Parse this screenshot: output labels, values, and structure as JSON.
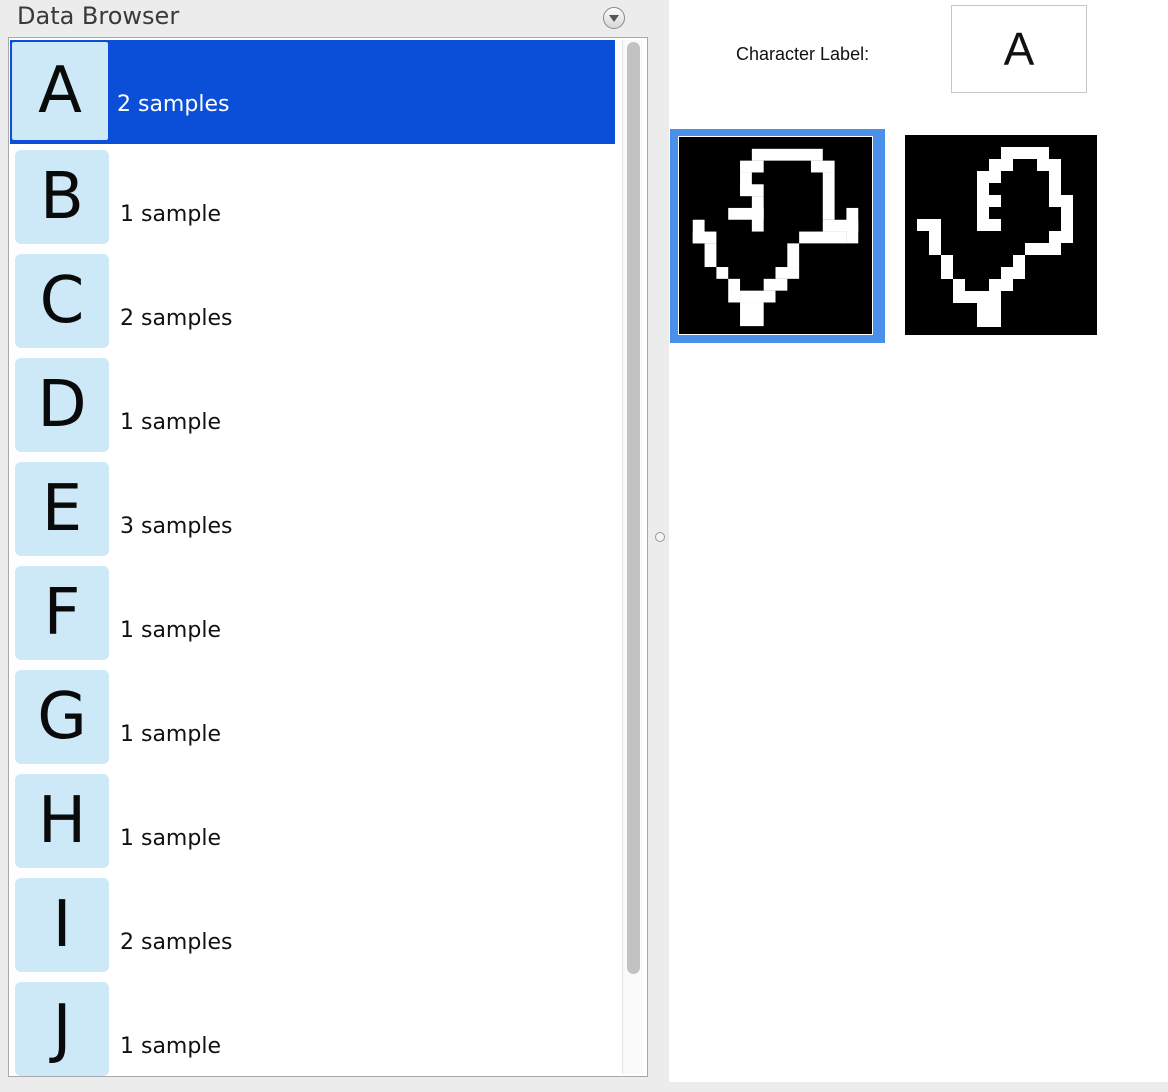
{
  "panel": {
    "title": "Data Browser",
    "menu_icon": "dropdown-circle-icon"
  },
  "list": {
    "items": [
      {
        "letter": "A",
        "count": "2 samples",
        "selected": true
      },
      {
        "letter": "B",
        "count": "1 sample",
        "selected": false
      },
      {
        "letter": "C",
        "count": "2 samples",
        "selected": false
      },
      {
        "letter": "D",
        "count": "1 sample",
        "selected": false
      },
      {
        "letter": "E",
        "count": "3 samples",
        "selected": false
      },
      {
        "letter": "F",
        "count": "1 sample",
        "selected": false
      },
      {
        "letter": "G",
        "count": "1 sample",
        "selected": false
      },
      {
        "letter": "H",
        "count": "1 sample",
        "selected": false
      },
      {
        "letter": "I",
        "count": "2 samples",
        "selected": false
      },
      {
        "letter": "J",
        "count": "1 sample",
        "selected": false
      }
    ],
    "scroll_fraction_visible": 0.9
  },
  "detail": {
    "label_caption": "Character Label:",
    "label_value": "A",
    "samples": [
      {
        "selected": true
      },
      {
        "selected": false
      }
    ]
  },
  "colors": {
    "selection": "#0b4fd9",
    "tile": "#cde9f8",
    "sample_focus": "#4a90e8"
  }
}
